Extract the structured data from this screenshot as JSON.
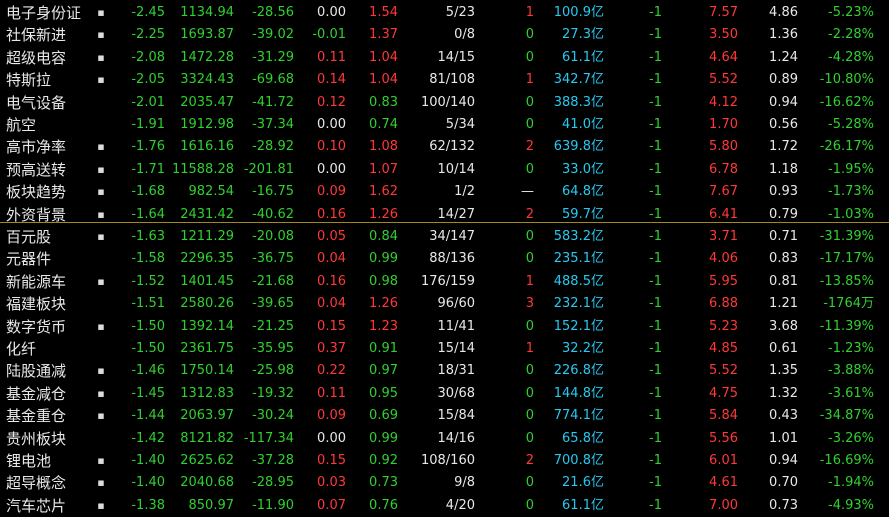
{
  "colors": {
    "background": "#000000",
    "up": "#ff3838",
    "down": "#30d030",
    "flat": "#e8e8e8",
    "amount": "#27c9f0",
    "divider": "#a08a1a"
  },
  "rows": [
    {
      "name": "电子身份证",
      "mark": "▪",
      "chg": "-2.45",
      "price": "1134.94",
      "diff": "-28.56",
      "c4": "0.00",
      "c5": "1.54",
      "ratio": "5/23",
      "lead": "1",
      "amount": "100.9",
      "unit": "亿",
      "c9": "-1",
      "c10": "7.57",
      "c11": "4.86",
      "c12": "-5.23%"
    },
    {
      "name": "社保新进",
      "mark": "▪",
      "chg": "-2.25",
      "price": "1693.87",
      "diff": "-39.02",
      "c4": "-0.01",
      "c5": "1.37",
      "ratio": "0/8",
      "lead": "0",
      "amount": "27.3",
      "unit": "亿",
      "c9": "-1",
      "c10": "3.50",
      "c11": "1.36",
      "c12": "-2.28%"
    },
    {
      "name": "超级电容",
      "mark": "▪",
      "chg": "-2.08",
      "price": "1472.28",
      "diff": "-31.29",
      "c4": "0.11",
      "c5": "1.04",
      "ratio": "14/15",
      "lead": "0",
      "amount": "61.1",
      "unit": "亿",
      "c9": "-1",
      "c10": "4.64",
      "c11": "1.24",
      "c12": "-4.28%"
    },
    {
      "name": "特斯拉",
      "mark": "▪",
      "chg": "-2.05",
      "price": "3324.43",
      "diff": "-69.68",
      "c4": "0.14",
      "c5": "1.04",
      "ratio": "81/108",
      "lead": "1",
      "amount": "342.7",
      "unit": "亿",
      "c9": "-1",
      "c10": "5.52",
      "c11": "0.89",
      "c12": "-10.80%"
    },
    {
      "name": "电气设备",
      "mark": "",
      "chg": "-2.01",
      "price": "2035.47",
      "diff": "-41.72",
      "c4": "0.12",
      "c5": "0.83",
      "ratio": "100/140",
      "lead": "0",
      "amount": "388.3",
      "unit": "亿",
      "c9": "-1",
      "c10": "4.12",
      "c11": "0.94",
      "c12": "-16.62%"
    },
    {
      "name": "航空",
      "mark": "",
      "chg": "-1.91",
      "price": "1912.98",
      "diff": "-37.34",
      "c4": "0.00",
      "c5": "0.74",
      "ratio": "5/34",
      "lead": "0",
      "amount": "41.0",
      "unit": "亿",
      "c9": "-1",
      "c10": "1.70",
      "c11": "0.56",
      "c12": "-5.28%"
    },
    {
      "name": "高市净率",
      "mark": "▪",
      "chg": "-1.76",
      "price": "1616.16",
      "diff": "-28.92",
      "c4": "0.10",
      "c5": "1.08",
      "ratio": "62/132",
      "lead": "2",
      "amount": "639.8",
      "unit": "亿",
      "c9": "-1",
      "c10": "5.80",
      "c11": "1.72",
      "c12": "-26.17%"
    },
    {
      "name": "预高送转",
      "mark": "▪",
      "chg": "-1.71",
      "price": "11588.28",
      "diff": "-201.81",
      "c4": "0.00",
      "c5": "1.07",
      "ratio": "10/14",
      "lead": "0",
      "amount": "33.0",
      "unit": "亿",
      "c9": "-1",
      "c10": "6.78",
      "c11": "1.18",
      "c12": "-1.95%"
    },
    {
      "name": "板块趋势",
      "mark": "▪",
      "chg": "-1.68",
      "price": "982.54",
      "diff": "-16.75",
      "c4": "0.09",
      "c5": "1.62",
      "ratio": "1/2",
      "lead": "—",
      "amount": "64.8",
      "unit": "亿",
      "c9": "-1",
      "c10": "7.67",
      "c11": "0.93",
      "c12": "-1.73%"
    },
    {
      "name": "外资背景",
      "mark": "▪",
      "chg": "-1.64",
      "price": "2431.42",
      "diff": "-40.62",
      "c4": "0.16",
      "c5": "1.26",
      "ratio": "14/27",
      "lead": "2",
      "amount": "59.7",
      "unit": "亿",
      "c9": "-1",
      "c10": "6.41",
      "c11": "0.79",
      "c12": "-1.03%"
    },
    {
      "name": "百元股",
      "mark": "▪",
      "chg": "-1.63",
      "price": "1211.29",
      "diff": "-20.08",
      "c4": "0.05",
      "c5": "0.84",
      "ratio": "34/147",
      "lead": "0",
      "amount": "583.2",
      "unit": "亿",
      "c9": "-1",
      "c10": "3.71",
      "c11": "0.71",
      "c12": "-31.39%"
    },
    {
      "name": "元器件",
      "mark": "",
      "chg": "-1.58",
      "price": "2296.35",
      "diff": "-36.75",
      "c4": "0.04",
      "c5": "0.99",
      "ratio": "88/136",
      "lead": "0",
      "amount": "235.1",
      "unit": "亿",
      "c9": "-1",
      "c10": "4.06",
      "c11": "0.83",
      "c12": "-17.17%"
    },
    {
      "name": "新能源车",
      "mark": "▪",
      "chg": "-1.52",
      "price": "1401.45",
      "diff": "-21.68",
      "c4": "0.16",
      "c5": "0.98",
      "ratio": "176/159",
      "lead": "1",
      "amount": "488.5",
      "unit": "亿",
      "c9": "-1",
      "c10": "5.95",
      "c11": "0.81",
      "c12": "-13.85%"
    },
    {
      "name": "福建板块",
      "mark": "",
      "chg": "-1.51",
      "price": "2580.26",
      "diff": "-39.65",
      "c4": "0.04",
      "c5": "1.26",
      "ratio": "96/60",
      "lead": "3",
      "amount": "232.1",
      "unit": "亿",
      "c9": "-1",
      "c10": "6.88",
      "c11": "1.21",
      "c12": "-1764万"
    },
    {
      "name": "数字货币",
      "mark": "▪",
      "chg": "-1.50",
      "price": "1392.14",
      "diff": "-21.25",
      "c4": "0.15",
      "c5": "1.23",
      "ratio": "11/41",
      "lead": "0",
      "amount": "152.1",
      "unit": "亿",
      "c9": "-1",
      "c10": "5.23",
      "c11": "3.68",
      "c12": "-11.39%"
    },
    {
      "name": "化纤",
      "mark": "",
      "chg": "-1.50",
      "price": "2361.75",
      "diff": "-35.95",
      "c4": "0.37",
      "c5": "0.91",
      "ratio": "15/14",
      "lead": "1",
      "amount": "32.2",
      "unit": "亿",
      "c9": "-1",
      "c10": "4.85",
      "c11": "0.61",
      "c12": "-1.23%"
    },
    {
      "name": "陆股通减",
      "mark": "▪",
      "chg": "-1.46",
      "price": "1750.14",
      "diff": "-25.98",
      "c4": "0.22",
      "c5": "0.97",
      "ratio": "18/31",
      "lead": "0",
      "amount": "226.8",
      "unit": "亿",
      "c9": "-1",
      "c10": "5.52",
      "c11": "1.35",
      "c12": "-3.88%"
    },
    {
      "name": "基金减仓",
      "mark": "▪",
      "chg": "-1.45",
      "price": "1312.83",
      "diff": "-19.32",
      "c4": "0.11",
      "c5": "0.95",
      "ratio": "30/68",
      "lead": "0",
      "amount": "144.8",
      "unit": "亿",
      "c9": "-1",
      "c10": "4.75",
      "c11": "1.32",
      "c12": "-3.61%"
    },
    {
      "name": "基金重仓",
      "mark": "▪",
      "chg": "-1.44",
      "price": "2063.97",
      "diff": "-30.24",
      "c4": "0.09",
      "c5": "0.69",
      "ratio": "15/84",
      "lead": "0",
      "amount": "774.1",
      "unit": "亿",
      "c9": "-1",
      "c10": "5.84",
      "c11": "0.43",
      "c12": "-34.87%"
    },
    {
      "name": "贵州板块",
      "mark": "",
      "chg": "-1.42",
      "price": "8121.82",
      "diff": "-117.34",
      "c4": "0.00",
      "c5": "0.99",
      "ratio": "14/16",
      "lead": "0",
      "amount": "65.8",
      "unit": "亿",
      "c9": "-1",
      "c10": "5.56",
      "c11": "1.01",
      "c12": "-3.26%"
    },
    {
      "name": "锂电池",
      "mark": "▪",
      "chg": "-1.40",
      "price": "2625.62",
      "diff": "-37.28",
      "c4": "0.15",
      "c5": "0.92",
      "ratio": "108/160",
      "lead": "2",
      "amount": "700.8",
      "unit": "亿",
      "c9": "-1",
      "c10": "6.01",
      "c11": "0.94",
      "c12": "-16.69%"
    },
    {
      "name": "超导概念",
      "mark": "▪",
      "chg": "-1.40",
      "price": "2040.68",
      "diff": "-28.95",
      "c4": "0.03",
      "c5": "0.73",
      "ratio": "9/8",
      "lead": "0",
      "amount": "21.6",
      "unit": "亿",
      "c9": "-1",
      "c10": "4.61",
      "c11": "0.70",
      "c12": "-1.94%"
    },
    {
      "name": "汽车芯片",
      "mark": "▪",
      "chg": "-1.38",
      "price": "850.97",
      "diff": "-11.90",
      "c4": "0.07",
      "c5": "0.76",
      "ratio": "4/20",
      "lead": "0",
      "amount": "61.1",
      "unit": "亿",
      "c9": "-1",
      "c10": "7.00",
      "c11": "0.73",
      "c12": "-4.93%"
    }
  ]
}
